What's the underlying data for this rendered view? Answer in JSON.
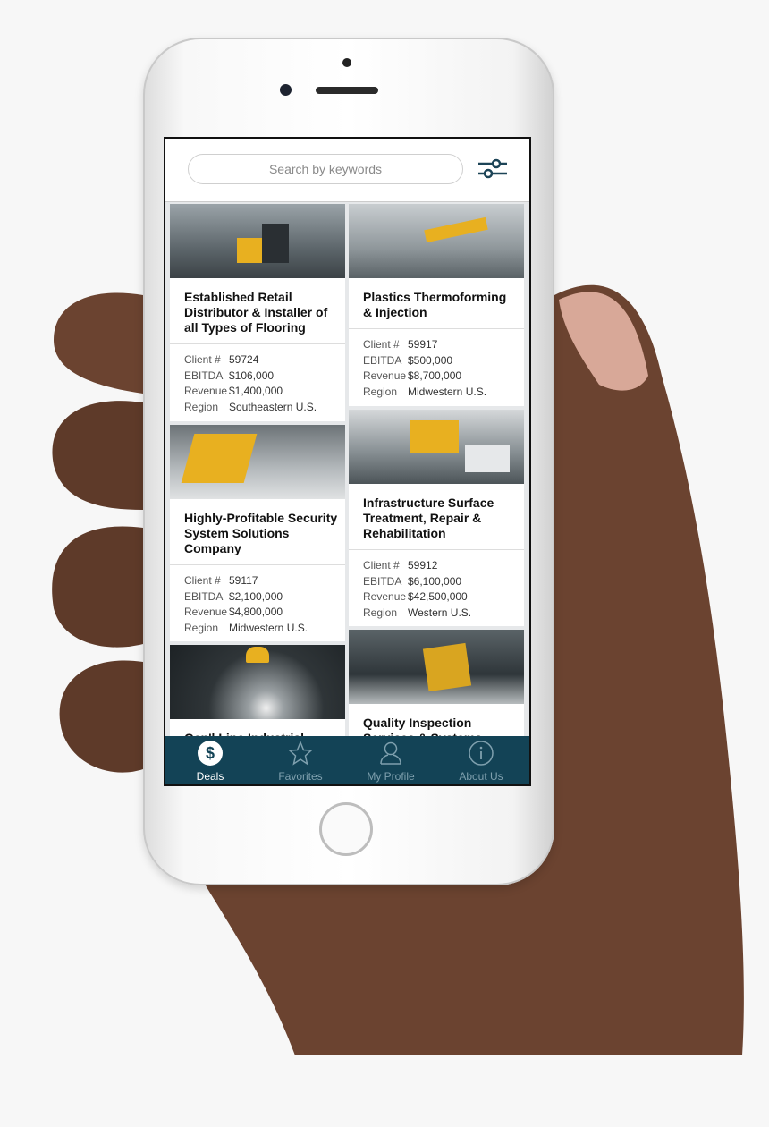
{
  "search": {
    "placeholder": "Search by keywords"
  },
  "labels": {
    "client": "Client #",
    "ebitda": "EBITDA",
    "revenue": "Revenue",
    "region": "Region"
  },
  "deals": [
    {
      "title": "Established Retail Distributor & Installer of all Types of Flooring",
      "client": "59724",
      "ebitda": "$106,000",
      "revenue": "$1,400,000",
      "region": "Southeastern U.S."
    },
    {
      "title": "Plastics Thermoforming & Injection",
      "client": "59917",
      "ebitda": "$500,000",
      "revenue": "$8,700,000",
      "region": "Midwestern U.S."
    },
    {
      "title": "Highly-Profitable Security System Solutions Company",
      "client": "59117",
      "ebitda": "$2,100,000",
      "revenue": "$4,800,000",
      "region": "Midwestern U.S."
    },
    {
      "title": "Infrastructure Surface Treatment, Repair & Rehabilitation",
      "client": "59912",
      "ebitda": "$6,100,000",
      "revenue": "$42,500,000",
      "region": "Western U.S."
    },
    {
      "title": "Gen'l Line Industrial"
    },
    {
      "title": "Quality Inspection Services & Systems"
    }
  ],
  "tabs": [
    {
      "label": "Deals",
      "icon": "dollar-icon",
      "active": true
    },
    {
      "label": "Favorites",
      "icon": "star-icon"
    },
    {
      "label": "My Profile",
      "icon": "profile-icon"
    },
    {
      "label": "About Us",
      "icon": "info-icon"
    }
  ],
  "colors": {
    "tabbar": "#134356",
    "accent": "#e8b020",
    "tab_inactive": "#7fa0ae"
  }
}
